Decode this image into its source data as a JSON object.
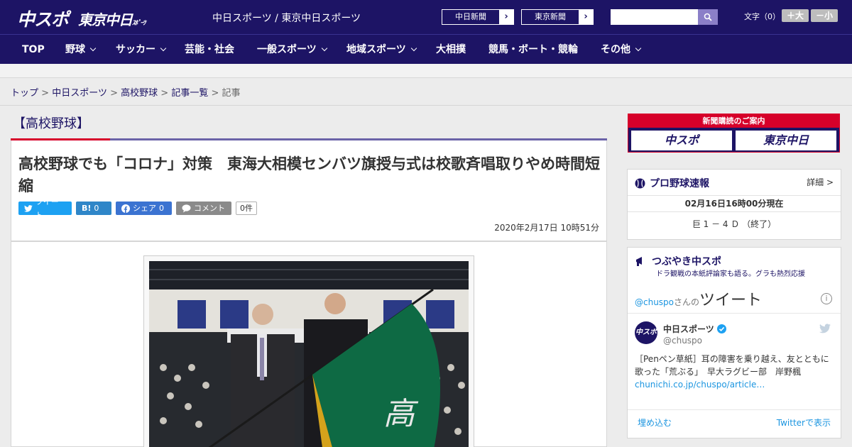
{
  "header": {
    "logo_chuspo": "中スポ",
    "logo_tokyo": "東京中日",
    "logo_tokyo_sub": "ｽﾎﾟｰﾂ",
    "site_links": "中日スポーツ / 東京中日スポーツ",
    "ext_links": [
      "中日新聞",
      "東京新聞"
    ],
    "search_placeholder": "",
    "font_size_label": "文字（0）",
    "font_plus": "＋大",
    "font_minus": "－小"
  },
  "nav": {
    "items": [
      {
        "label": "TOP",
        "dropdown": false
      },
      {
        "label": "野球",
        "dropdown": true
      },
      {
        "label": "サッカー",
        "dropdown": true
      },
      {
        "label": "芸能・社会",
        "dropdown": false
      },
      {
        "label": "一般スポーツ",
        "dropdown": true
      },
      {
        "label": "地域スポーツ",
        "dropdown": true
      },
      {
        "label": "大相撲",
        "dropdown": false
      },
      {
        "label": "競馬・ボート・競輪",
        "dropdown": false
      },
      {
        "label": "その他",
        "dropdown": true
      }
    ]
  },
  "breadcrumb": {
    "items": [
      "トップ",
      "中日スポーツ",
      "高校野球",
      "記事一覧"
    ],
    "current": "記事",
    "separator": ">"
  },
  "article": {
    "category": "【高校野球】",
    "headline": "高校野球でも「コロナ」対策　東海大相模センバツ旗授与式は校歌斉唱取りやめ時間短縮",
    "share": {
      "tweet": "ツイート",
      "hatena_count": "0",
      "facebook": "シェア",
      "facebook_count": "0",
      "comment": "コメント",
      "comment_count": "0件"
    },
    "date": "2020年2月17日 10時51分"
  },
  "sidebar": {
    "ad": {
      "title": "新聞購読のご案内",
      "logo1": "中スポ",
      "logo2": "東京中日"
    },
    "baseball": {
      "title": "プロ野球速報",
      "detail": "詳細 >",
      "timestamp": "02月16日16時00分現在",
      "score": "巨 1 － 4 Ｄ （終了）"
    },
    "twitter": {
      "title": "つぶやき中スポ",
      "subtitle": "ドラ観戦の本紙評論家も語る。グラも熱烈応援",
      "handle_header": "@chuspo",
      "header_suffix": "さんの",
      "header_big": "ツイート",
      "info": "i",
      "avatar_text": "中スポ",
      "account_name": "中日スポーツ",
      "account_handle": "@chuspo",
      "tweet_text": "［Penペン草紙］耳の障害を乗り越え、友とともに歌った「荒ぶる」　早大ラグビー部　岸野楓",
      "tweet_link": "chunichi.co.jp/chuspo/article…",
      "embed": "埋め込む",
      "view_on": "Twitterで表示"
    }
  },
  "colors": {
    "brand_navy": "#1d1465",
    "accent_red": "#d6002a",
    "twitter_blue": "#1b95e0"
  }
}
